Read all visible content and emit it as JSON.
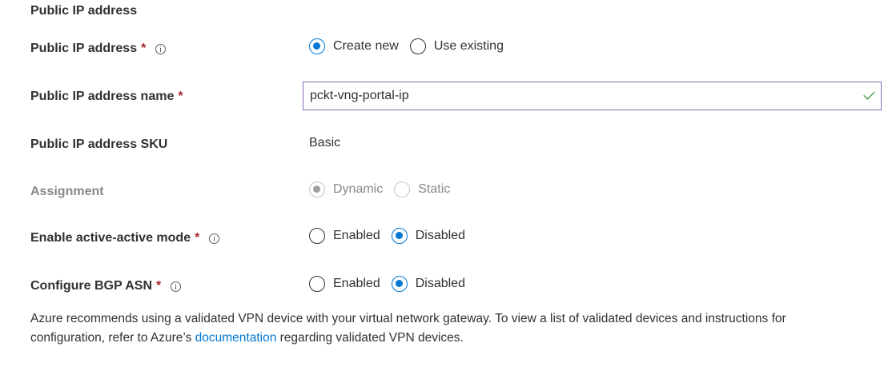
{
  "section": {
    "title": "Public IP address"
  },
  "public_ip": {
    "label": "Public IP address",
    "required_mark": "*",
    "options": [
      "Create new",
      "Use existing"
    ],
    "selected": "Create new"
  },
  "public_ip_name": {
    "label": "Public IP address name",
    "required_mark": "*",
    "value": "pckt-vng-portal-ip"
  },
  "public_ip_sku": {
    "label": "Public IP address SKU",
    "value": "Basic"
  },
  "assignment": {
    "label": "Assignment",
    "options": [
      "Dynamic",
      "Static"
    ],
    "selected": "Dynamic",
    "disabled": true
  },
  "active_active": {
    "label": "Enable active-active mode",
    "required_mark": "*",
    "options": [
      "Enabled",
      "Disabled"
    ],
    "selected": "Disabled"
  },
  "bgp_asn": {
    "label": "Configure BGP ASN",
    "required_mark": "*",
    "options": [
      "Enabled",
      "Disabled"
    ],
    "selected": "Disabled"
  },
  "note": {
    "text_before": "Azure recommends using a validated VPN device with your virtual network gateway. To view a list of validated devices and instructions for configuration, refer to Azure’s ",
    "link_text": "documentation",
    "text_after": " regarding validated VPN devices."
  },
  "colors": {
    "accent": "#0078d4",
    "required": "#a4262c",
    "valid_check": "#107c10",
    "input_border": "#8764b8"
  }
}
